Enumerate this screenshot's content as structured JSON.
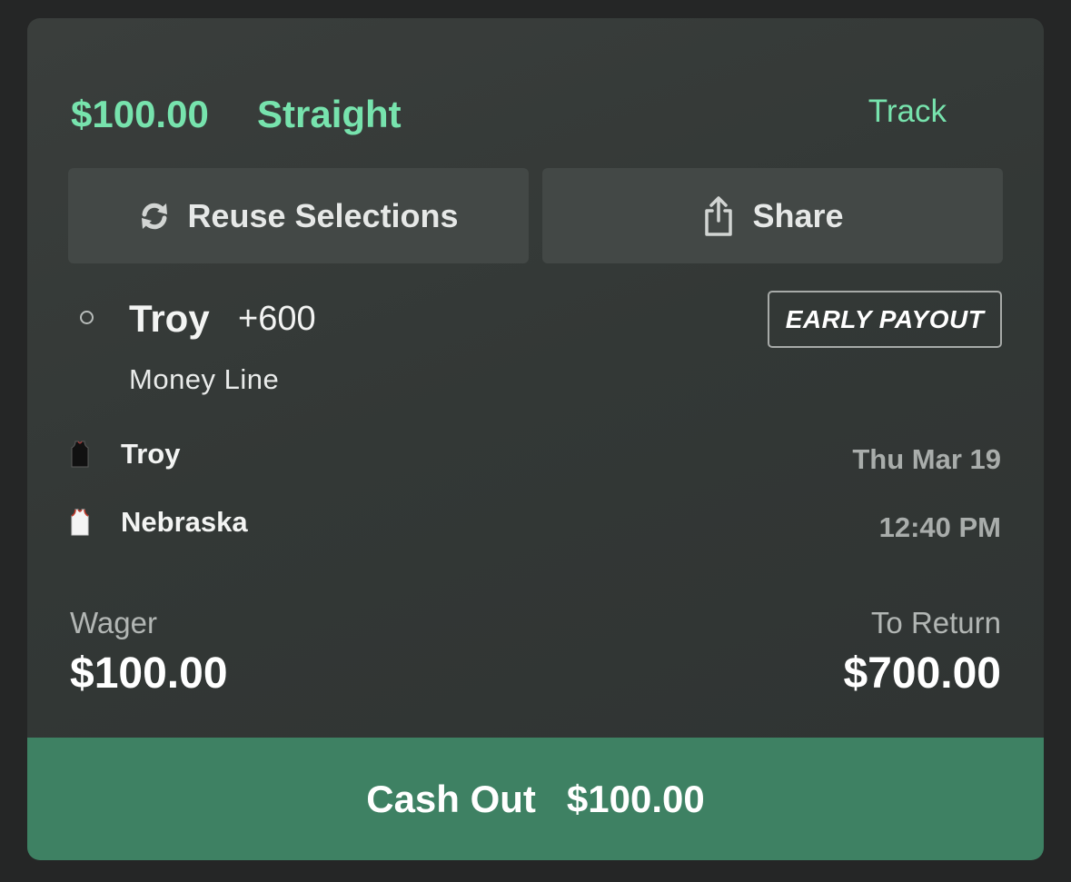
{
  "bet": {
    "amount": "$100.00",
    "type": "Straight",
    "track_label": "Track"
  },
  "actions": {
    "reuse_label": "Reuse Selections",
    "reuse_icon": "refresh-icon",
    "share_label": "Share",
    "share_icon": "share-icon"
  },
  "selection": {
    "team": "Troy",
    "odds": "+600",
    "market": "Money Line",
    "badge": "EARLY PAYOUT"
  },
  "matchup": {
    "teams": [
      {
        "name": "Troy",
        "jersey_icon": "black-jersey-icon"
      },
      {
        "name": "Nebraska",
        "jersey_icon": "white-jersey-icon"
      }
    ],
    "date": "Thu Mar 19",
    "time": "12:40 PM"
  },
  "summary": {
    "wager_label": "Wager",
    "wager_value": "$100.00",
    "return_label": "To Return",
    "return_value": "$700.00"
  },
  "cashout": {
    "label": "Cash Out",
    "amount": "$100.00"
  },
  "colors": {
    "accent": "#77e3ad",
    "cashout_bg": "#3e8163",
    "card_bg": "#343837",
    "button_bg": "#434846"
  }
}
